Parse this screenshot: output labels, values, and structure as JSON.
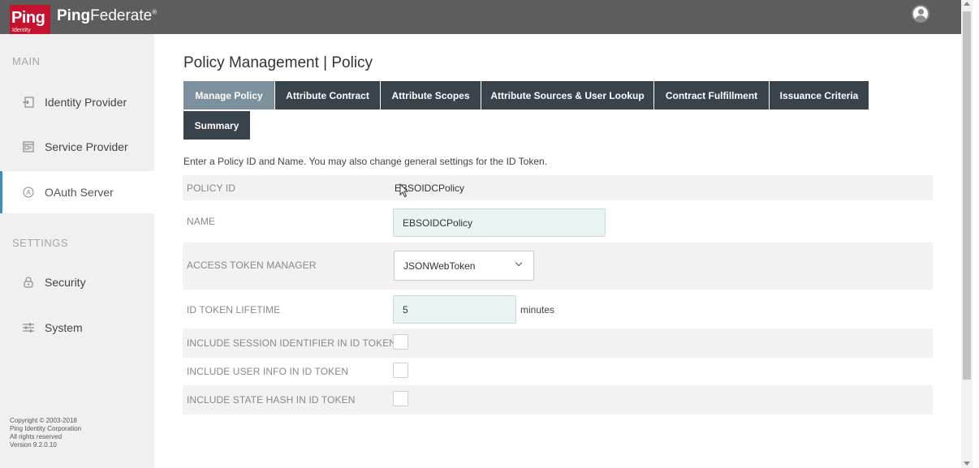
{
  "header": {
    "logo_text": "Ping",
    "logo_subtext": "Identity",
    "product_bold": "Ping",
    "product_light": "Federate",
    "product_mark": "®",
    "user_icon": "user-avatar-icon"
  },
  "sidebar": {
    "main_label": "MAIN",
    "settings_label": "SETTINGS",
    "items": [
      {
        "label": "Identity Provider",
        "icon": "identity-provider-icon"
      },
      {
        "label": "Service Provider",
        "icon": "service-provider-icon"
      },
      {
        "label": "OAuth Server",
        "icon": "oauth-server-icon",
        "active": true
      },
      {
        "label": "Security",
        "icon": "lock-icon"
      },
      {
        "label": "System",
        "icon": "sliders-icon"
      }
    ],
    "copyright": [
      "Copyright © 2003-2018",
      "Ping Identity Corporation",
      "All rights reserved",
      "Version 9.2.0.10"
    ]
  },
  "main": {
    "title": "Policy Management | Policy",
    "tabs": [
      {
        "label": "Manage Policy",
        "active": true
      },
      {
        "label": "Attribute Contract"
      },
      {
        "label": "Attribute Scopes"
      },
      {
        "label": "Attribute Sources & User Lookup"
      },
      {
        "label": "Contract Fulfillment"
      },
      {
        "label": "Issuance Criteria"
      },
      {
        "label": "Summary"
      }
    ],
    "instructions": "Enter a Policy ID and Name. You may also change general settings for the ID Token.",
    "form": {
      "policy_id_label": "POLICY ID",
      "policy_id_value": "EBSOIDCPolicy",
      "name_label": "NAME",
      "name_value": "EBSOIDCPolicy",
      "access_token_manager_label": "ACCESS TOKEN MANAGER",
      "access_token_manager_value": "JSONWebToken",
      "id_token_lifetime_label": "ID TOKEN LIFETIME",
      "id_token_lifetime_value": "5",
      "id_token_lifetime_units": "minutes",
      "include_session_label": "INCLUDE SESSION IDENTIFIER IN ID TOKEN",
      "include_session_checked": false,
      "include_user_info_label": "INCLUDE USER INFO IN ID TOKEN",
      "include_user_info_checked": false,
      "include_state_hash_label": "INCLUDE STATE HASH IN ID TOKEN",
      "include_state_hash_checked": false
    }
  },
  "colors": {
    "topbar": "#5d5d5d",
    "brand_red": "#c4122f",
    "tab_dark": "#39434c",
    "tab_active": "#7c909e",
    "active_accent": "#3a8fc2"
  }
}
